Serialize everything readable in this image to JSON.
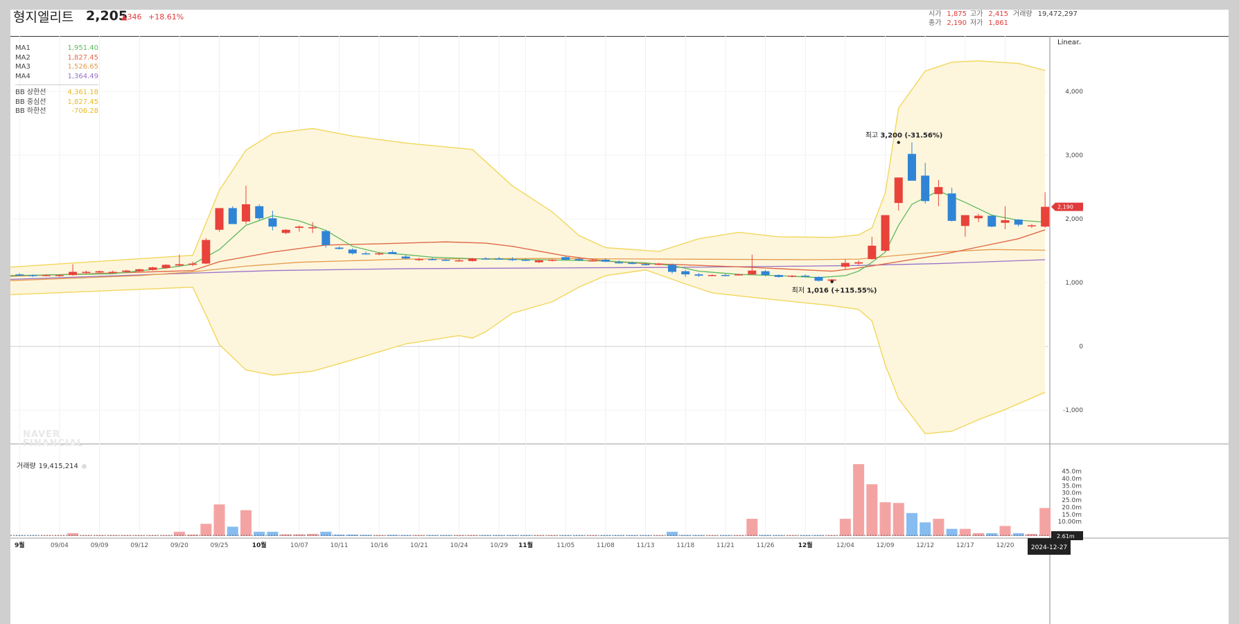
{
  "header": {
    "name": "형지엘리트",
    "price": "2,205",
    "change": "▲346",
    "change_rate": "+18.61%"
  },
  "quotes": {
    "open": {
      "label": "시가",
      "value": "1,875"
    },
    "high": {
      "label": "고가",
      "value": "2,415"
    },
    "close": {
      "label": "종가",
      "value": "2,190"
    },
    "low": {
      "label": "저가",
      "value": "1,861"
    },
    "volume": {
      "label": "거래량",
      "value": "19,472,297"
    }
  },
  "legend": {
    "ma": [
      {
        "name": "MA1",
        "value": "1,951.40",
        "color": "#5cb85c"
      },
      {
        "name": "MA2",
        "value": "1,827.45",
        "color": "#e06a4a"
      },
      {
        "name": "MA3",
        "value": "1,526.65",
        "color": "#e59a4b"
      },
      {
        "name": "MA4",
        "value": "1,364.49",
        "color": "#9a70c8"
      }
    ],
    "bb": [
      {
        "name": "BB 상한선",
        "value": "4,361.18",
        "color": "#e8b923"
      },
      {
        "name": "BB 중심선",
        "value": "1,827.45",
        "color": "#e8b923"
      },
      {
        "name": "BB 하한선",
        "value": "-706.28",
        "color": "#e8b923"
      }
    ]
  },
  "scale_label": "Linear",
  "watermark": [
    "NAVER",
    "FINANCIAL"
  ],
  "volume_panel": {
    "label": "거래량",
    "value": "19,415,214"
  },
  "annotations": {
    "high": {
      "label": "최고",
      "value": "3,200 (-31.56%)"
    },
    "low": {
      "label": "최저",
      "value": "1,016 (+115.55%)"
    }
  },
  "price_tag": "2,190",
  "volume_tag": "2.61m",
  "date_tag": "2024-12-27",
  "colors": {
    "up": "#e8423a",
    "down": "#2f84d6",
    "vol_up": "#f4a3a3",
    "vol_down": "#86bcf0",
    "band_fill": "#fdf6dd",
    "band_line": "#f2d65a"
  },
  "chart_data": {
    "type": "candlestick",
    "price_axis": {
      "ticks": [
        -1000,
        0,
        1000,
        2000,
        3000,
        4000
      ],
      "tick_labels": [
        "-1,000",
        "0",
        "1,000",
        "2,000",
        "3,000",
        "4,000"
      ],
      "ylim": [
        -1530,
        4870
      ]
    },
    "volume_axis": {
      "unit": "m",
      "ticks": [
        10,
        15,
        20,
        25,
        30,
        35,
        40,
        45
      ],
      "tick_labels": [
        "10.00m",
        "15.0m",
        "20.0m",
        "25.0m",
        "30.0m",
        "35.0m",
        "40.0m",
        "45.0m"
      ],
      "ylim": [
        0,
        52
      ]
    },
    "x_labels": [
      {
        "i": 1,
        "label": "9월",
        "bold": true
      },
      {
        "i": 4,
        "label": "09/04"
      },
      {
        "i": 7,
        "label": "09/09"
      },
      {
        "i": 10,
        "label": "09/12"
      },
      {
        "i": 13,
        "label": "09/20"
      },
      {
        "i": 16,
        "label": "09/25"
      },
      {
        "i": 19,
        "label": "10월",
        "bold": true
      },
      {
        "i": 22,
        "label": "10/07"
      },
      {
        "i": 25,
        "label": "10/11"
      },
      {
        "i": 28,
        "label": "10/16"
      },
      {
        "i": 31,
        "label": "10/21"
      },
      {
        "i": 34,
        "label": "10/24"
      },
      {
        "i": 37,
        "label": "10/29"
      },
      {
        "i": 39,
        "label": "11월",
        "bold": true
      },
      {
        "i": 42,
        "label": "11/05"
      },
      {
        "i": 45,
        "label": "11/08"
      },
      {
        "i": 48,
        "label": "11/13"
      },
      {
        "i": 51,
        "label": "11/18"
      },
      {
        "i": 54,
        "label": "11/21"
      },
      {
        "i": 57,
        "label": "11/26"
      },
      {
        "i": 60,
        "label": "12월",
        "bold": true
      },
      {
        "i": 63,
        "label": "12/04"
      },
      {
        "i": 66,
        "label": "12/09"
      },
      {
        "i": 69,
        "label": "12/12"
      },
      {
        "i": 72,
        "label": "12/17"
      },
      {
        "i": 75,
        "label": "12/20"
      }
    ],
    "candles": [
      [
        1120,
        1140,
        1100,
        1130
      ],
      [
        1130,
        1150,
        1110,
        1120
      ],
      [
        1120,
        1130,
        1090,
        1115
      ],
      [
        1115,
        1135,
        1100,
        1120
      ],
      [
        1110,
        1130,
        1090,
        1120
      ],
      [
        1120,
        1290,
        1110,
        1170
      ],
      [
        1160,
        1190,
        1140,
        1170
      ],
      [
        1160,
        1190,
        1150,
        1180
      ],
      [
        1170,
        1190,
        1150,
        1170
      ],
      [
        1170,
        1200,
        1160,
        1190
      ],
      [
        1180,
        1220,
        1170,
        1210
      ],
      [
        1200,
        1250,
        1190,
        1240
      ],
      [
        1230,
        1290,
        1220,
        1280
      ],
      [
        1270,
        1440,
        1250,
        1290
      ],
      [
        1280,
        1330,
        1260,
        1300
      ],
      [
        1300,
        1700,
        1290,
        1670
      ],
      [
        1830,
        2170,
        1800,
        2170
      ],
      [
        2170,
        2200,
        1930,
        1920
      ],
      [
        1960,
        2520,
        1920,
        2230
      ],
      [
        2200,
        2230,
        1980,
        2010
      ],
      [
        2010,
        2130,
        1820,
        1880
      ],
      [
        1780,
        1840,
        1760,
        1830
      ],
      [
        1860,
        1900,
        1800,
        1880
      ],
      [
        1860,
        1950,
        1780,
        1870
      ],
      [
        1810,
        1830,
        1550,
        1590
      ],
      [
        1550,
        1570,
        1520,
        1530
      ],
      [
        1520,
        1540,
        1440,
        1460
      ],
      [
        1460,
        1490,
        1440,
        1450
      ],
      [
        1450,
        1480,
        1430,
        1460
      ],
      [
        1480,
        1510,
        1450,
        1450
      ],
      [
        1410,
        1430,
        1370,
        1380
      ],
      [
        1360,
        1390,
        1340,
        1370
      ],
      [
        1370,
        1390,
        1350,
        1360
      ],
      [
        1360,
        1380,
        1340,
        1350
      ],
      [
        1340,
        1370,
        1330,
        1350
      ],
      [
        1340,
        1390,
        1330,
        1380
      ],
      [
        1380,
        1400,
        1360,
        1370
      ],
      [
        1380,
        1400,
        1360,
        1370
      ],
      [
        1370,
        1400,
        1340,
        1360
      ],
      [
        1360,
        1380,
        1340,
        1350
      ],
      [
        1320,
        1360,
        1310,
        1350
      ],
      [
        1350,
        1370,
        1330,
        1360
      ],
      [
        1400,
        1410,
        1350,
        1360
      ],
      [
        1370,
        1390,
        1340,
        1350
      ],
      [
        1340,
        1370,
        1330,
        1350
      ],
      [
        1360,
        1380,
        1320,
        1330
      ],
      [
        1320,
        1350,
        1300,
        1310
      ],
      [
        1310,
        1330,
        1290,
        1300
      ],
      [
        1290,
        1310,
        1270,
        1280
      ],
      [
        1280,
        1310,
        1270,
        1300
      ],
      [
        1280,
        1300,
        1140,
        1170
      ],
      [
        1180,
        1200,
        1090,
        1130
      ],
      [
        1130,
        1150,
        1090,
        1110
      ],
      [
        1110,
        1130,
        1100,
        1120
      ],
      [
        1120,
        1140,
        1100,
        1110
      ],
      [
        1120,
        1140,
        1110,
        1130
      ],
      [
        1130,
        1440,
        1120,
        1190
      ],
      [
        1180,
        1200,
        1100,
        1120
      ],
      [
        1120,
        1130,
        1080,
        1090
      ],
      [
        1100,
        1120,
        1080,
        1110
      ],
      [
        1110,
        1130,
        1090,
        1100
      ],
      [
        1090,
        1100,
        1020,
        1030
      ],
      [
        1030,
        1060,
        1016,
        1050
      ],
      [
        1250,
        1370,
        1210,
        1310
      ],
      [
        1300,
        1350,
        1280,
        1320
      ],
      [
        1370,
        1720,
        1360,
        1580
      ],
      [
        1500,
        2060,
        1490,
        2060
      ],
      [
        2250,
        2650,
        2130,
        2650
      ],
      [
        3020,
        3200,
        2630,
        2600
      ],
      [
        2680,
        2880,
        2240,
        2280
      ],
      [
        2390,
        2610,
        2200,
        2500
      ],
      [
        2400,
        2490,
        1960,
        1970
      ],
      [
        1890,
        2060,
        1720,
        2060
      ],
      [
        2010,
        2080,
        1950,
        2050
      ],
      [
        2050,
        2060,
        1870,
        1880
      ],
      [
        1940,
        2200,
        1840,
        1980
      ],
      [
        1990,
        2000,
        1880,
        1910
      ],
      [
        1890,
        1920,
        1860,
        1900
      ],
      [
        1880,
        2420,
        1860,
        2190
      ]
    ],
    "volume": [
      0.3,
      0.3,
      0.3,
      0.3,
      0.3,
      2,
      0.5,
      0.5,
      0.5,
      0.5,
      0.5,
      0.5,
      0.5,
      3,
      1,
      8.5,
      22,
      6.5,
      18,
      3,
      3,
      1.2,
      1.2,
      1.5,
      3,
      1,
      1,
      0.8,
      0.6,
      0.8,
      0.6,
      0.6,
      0.6,
      0.6,
      0.6,
      0.6,
      0.6,
      0.6,
      0.6,
      0.6,
      0.5,
      0.5,
      0.5,
      0.5,
      0.5,
      0.5,
      0.5,
      0.5,
      0.5,
      0.5,
      3,
      0.7,
      0.6,
      0.5,
      0.5,
      0.5,
      12,
      0.7,
      0.5,
      0.5,
      0.5,
      0.5,
      0.5,
      12,
      50,
      36,
      23.5,
      23,
      16,
      9.5,
      12,
      5,
      5,
      2,
      2,
      7,
      2,
      1.5,
      19.5
    ],
    "bb_upper": [
      [
        0,
        1240
      ],
      [
        14,
        1430
      ],
      [
        16,
        2450
      ],
      [
        18,
        3080
      ],
      [
        20,
        3340
      ],
      [
        23,
        3420
      ],
      [
        26,
        3300
      ],
      [
        30,
        3190
      ],
      [
        35,
        3090
      ],
      [
        36,
        2900
      ],
      [
        38,
        2520
      ],
      [
        41,
        2110
      ],
      [
        43,
        1740
      ],
      [
        45,
        1550
      ],
      [
        49,
        1490
      ],
      [
        52,
        1690
      ],
      [
        55,
        1790
      ],
      [
        58,
        1720
      ],
      [
        62,
        1710
      ],
      [
        64,
        1750
      ],
      [
        65,
        1860
      ],
      [
        66,
        2410
      ],
      [
        67,
        3740
      ],
      [
        69,
        4320
      ],
      [
        71,
        4460
      ],
      [
        73,
        4480
      ],
      [
        76,
        4440
      ],
      [
        78,
        4330
      ]
    ],
    "bb_lower": [
      [
        0,
        810
      ],
      [
        6,
        860
      ],
      [
        14,
        930
      ],
      [
        15,
        490
      ],
      [
        16,
        30
      ],
      [
        18,
        -370
      ],
      [
        20,
        -450
      ],
      [
        23,
        -390
      ],
      [
        26,
        -210
      ],
      [
        30,
        40
      ],
      [
        34,
        170
      ],
      [
        35,
        130
      ],
      [
        36,
        230
      ],
      [
        38,
        520
      ],
      [
        41,
        700
      ],
      [
        43,
        930
      ],
      [
        45,
        1110
      ],
      [
        48,
        1200
      ],
      [
        51,
        980
      ],
      [
        53,
        840
      ],
      [
        56,
        770
      ],
      [
        62,
        640
      ],
      [
        64,
        580
      ],
      [
        65,
        400
      ],
      [
        66,
        -290
      ],
      [
        67,
        -820
      ],
      [
        69,
        -1370
      ],
      [
        71,
        -1330
      ],
      [
        73,
        -1150
      ],
      [
        75,
        -990
      ],
      [
        78,
        -720
      ]
    ],
    "bb_mid": [
      [
        0,
        1100
      ],
      [
        14,
        1190
      ],
      [
        16,
        1330
      ],
      [
        20,
        1480
      ],
      [
        24,
        1590
      ],
      [
        28,
        1610
      ],
      [
        33,
        1640
      ],
      [
        36,
        1620
      ],
      [
        38,
        1570
      ],
      [
        42,
        1420
      ],
      [
        45,
        1340
      ],
      [
        48,
        1300
      ],
      [
        51,
        1280
      ],
      [
        56,
        1240
      ],
      [
        62,
        1180
      ],
      [
        64,
        1230
      ],
      [
        67,
        1330
      ],
      [
        70,
        1430
      ],
      [
        73,
        1560
      ],
      [
        76,
        1690
      ],
      [
        78,
        1830
      ]
    ],
    "ma1": [
      [
        0,
        1110
      ],
      [
        8,
        1140
      ],
      [
        12,
        1230
      ],
      [
        14,
        1290
      ],
      [
        16,
        1520
      ],
      [
        18,
        1900
      ],
      [
        20,
        2050
      ],
      [
        22,
        1970
      ],
      [
        24,
        1820
      ],
      [
        26,
        1570
      ],
      [
        28,
        1470
      ],
      [
        30,
        1440
      ],
      [
        32,
        1400
      ],
      [
        36,
        1370
      ],
      [
        40,
        1360
      ],
      [
        45,
        1340
      ],
      [
        48,
        1310
      ],
      [
        50,
        1270
      ],
      [
        52,
        1180
      ],
      [
        55,
        1130
      ],
      [
        58,
        1110
      ],
      [
        61,
        1080
      ],
      [
        63,
        1110
      ],
      [
        64,
        1180
      ],
      [
        65,
        1320
      ],
      [
        66,
        1480
      ],
      [
        67,
        1900
      ],
      [
        68,
        2230
      ],
      [
        70,
        2440
      ],
      [
        72,
        2260
      ],
      [
        74,
        2060
      ],
      [
        76,
        1980
      ],
      [
        78,
        1950
      ]
    ],
    "ma2": [
      [
        0,
        1100
      ],
      [
        14,
        1190
      ],
      [
        16,
        1330
      ],
      [
        20,
        1480
      ],
      [
        24,
        1590
      ],
      [
        28,
        1610
      ],
      [
        33,
        1640
      ],
      [
        36,
        1620
      ],
      [
        38,
        1570
      ],
      [
        42,
        1420
      ],
      [
        45,
        1340
      ],
      [
        48,
        1300
      ],
      [
        51,
        1280
      ],
      [
        56,
        1240
      ],
      [
        62,
        1180
      ],
      [
        64,
        1230
      ],
      [
        67,
        1330
      ],
      [
        70,
        1430
      ],
      [
        73,
        1560
      ],
      [
        76,
        1690
      ],
      [
        78,
        1830
      ]
    ],
    "ma3": [
      [
        0,
        1030
      ],
      [
        10,
        1110
      ],
      [
        14,
        1170
      ],
      [
        18,
        1260
      ],
      [
        22,
        1320
      ],
      [
        30,
        1370
      ],
      [
        40,
        1380
      ],
      [
        50,
        1370
      ],
      [
        60,
        1360
      ],
      [
        64,
        1370
      ],
      [
        67,
        1430
      ],
      [
        70,
        1480
      ],
      [
        74,
        1520
      ],
      [
        78,
        1510
      ]
    ],
    "ma4": [
      [
        0,
        1050
      ],
      [
        14,
        1150
      ],
      [
        20,
        1190
      ],
      [
        30,
        1220
      ],
      [
        40,
        1230
      ],
      [
        50,
        1240
      ],
      [
        60,
        1260
      ],
      [
        64,
        1270
      ],
      [
        70,
        1300
      ],
      [
        78,
        1360
      ]
    ]
  }
}
